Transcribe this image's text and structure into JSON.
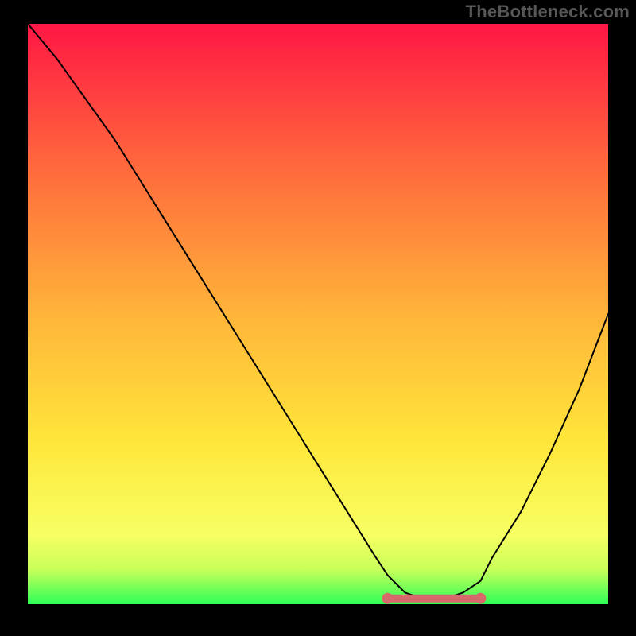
{
  "attribution": "TheBottleneck.com",
  "colors": {
    "gradient": [
      {
        "offset": "0%",
        "hex": "#ff1744"
      },
      {
        "offset": "25%",
        "hex": "#ff6a3c"
      },
      {
        "offset": "50%",
        "hex": "#ffb43a"
      },
      {
        "offset": "72%",
        "hex": "#ffe63a"
      },
      {
        "offset": "88%",
        "hex": "#f7ff63"
      },
      {
        "offset": "94%",
        "hex": "#c9ff5a"
      },
      {
        "offset": "100%",
        "hex": "#2dff57"
      }
    ],
    "curve": "#000000",
    "optimal_marker": "#d66a6a",
    "frame": "#000000"
  },
  "chart_data": {
    "type": "line",
    "title": "",
    "xlabel": "",
    "ylabel": "",
    "xlim": [
      0,
      100
    ],
    "ylim": [
      0,
      100
    ],
    "x": [
      0,
      5,
      10,
      15,
      20,
      25,
      30,
      35,
      40,
      45,
      50,
      55,
      60,
      62,
      65,
      68,
      70,
      72,
      75,
      78,
      80,
      85,
      90,
      95,
      100
    ],
    "y": [
      100,
      94,
      87,
      80,
      72,
      64,
      56,
      48,
      40,
      32,
      24,
      16,
      8,
      5,
      2,
      1,
      1,
      1,
      2,
      4,
      8,
      16,
      26,
      37,
      50
    ],
    "optimal_range_x": [
      62,
      78
    ],
    "optimal_range_y": 1
  }
}
